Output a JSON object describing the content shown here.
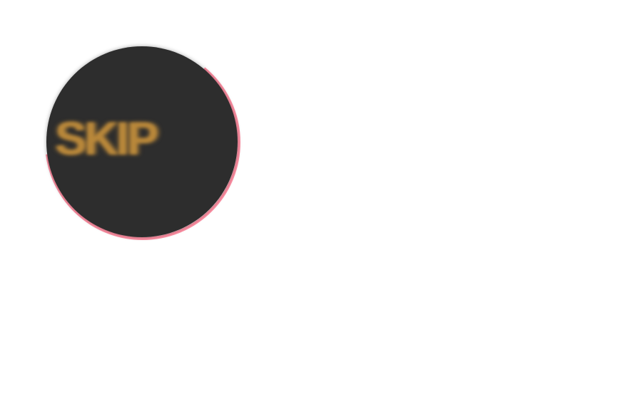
{
  "skip": {
    "label": "SKIP",
    "progress": 0.62
  },
  "colors": {
    "background": "#ffffff",
    "button": "#2d2d2d",
    "label": "#b8873a",
    "progress_ring": "#ff8fa3"
  }
}
